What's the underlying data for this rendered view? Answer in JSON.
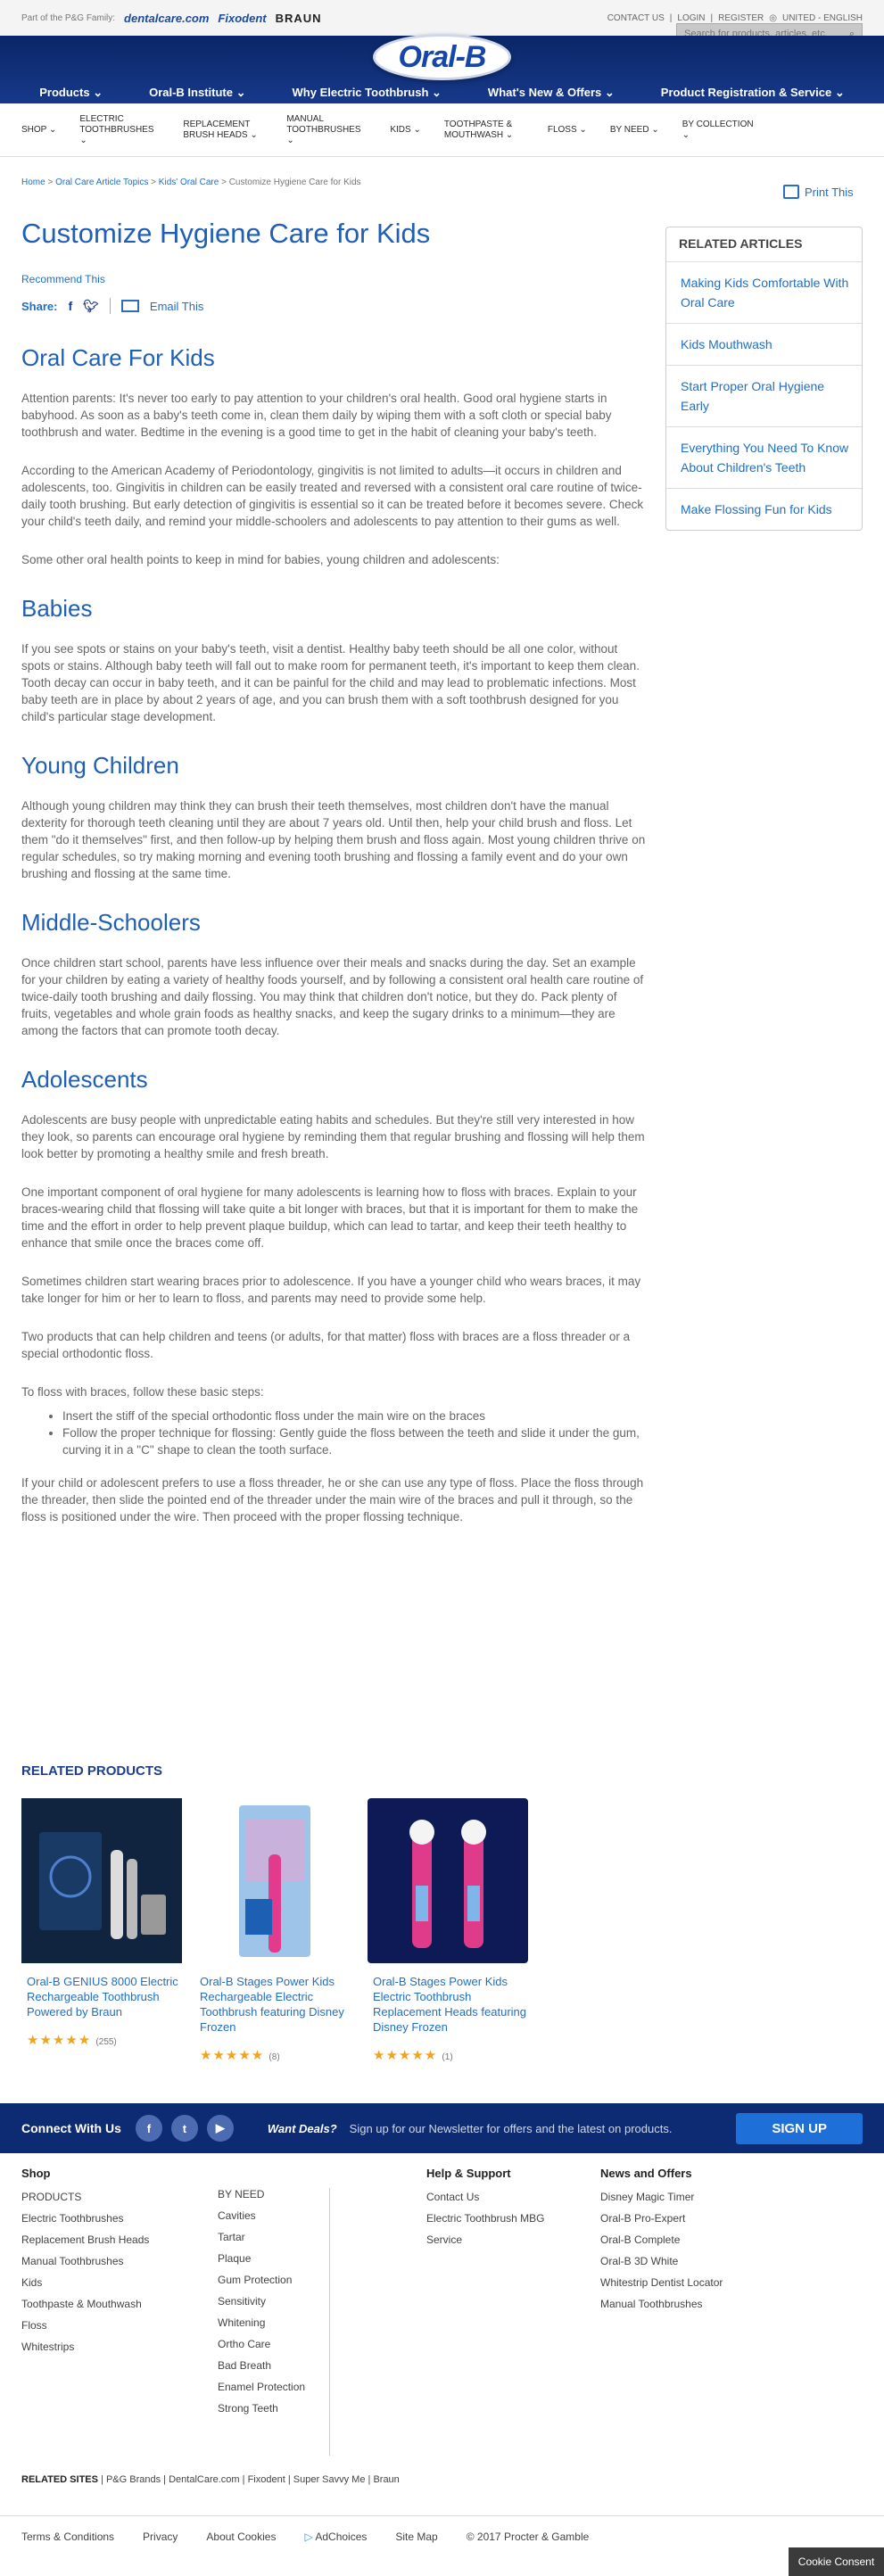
{
  "topbar": {
    "family_label": "Part of the P&G Family:",
    "brands": [
      "dentalcare.com",
      "Fixodent",
      "BRAUN"
    ],
    "contact": "CONTACT US",
    "login": "LOGIN",
    "register": "REGISTER",
    "region": "UNITED - ENGLISH"
  },
  "search": {
    "placeholder": "Search for products, articles, etc."
  },
  "logo": "Oral-B",
  "main_nav": [
    "Products",
    "Oral-B Institute",
    "Why Electric Toothbrush",
    "What's New & Offers",
    "Product Registration & Service"
  ],
  "category_nav": [
    "SHOP",
    "ELECTRIC TOOTHBRUSHES",
    "REPLACEMENT BRUSH HEADS",
    "MANUAL TOOTHBRUSHES",
    "KIDS",
    "TOOTHPASTE & MOUTHWASH",
    "FLOSS",
    "BY NEED",
    "BY COLLECTION"
  ],
  "breadcrumbs": [
    "Home",
    "Oral Care Article Topics",
    "Kids' Oral Care",
    "Customize Hygiene Care for Kids"
  ],
  "print_label": "Print This",
  "article": {
    "title": "Customize Hygiene Care for Kids",
    "recommend": "Recommend This",
    "share_label": "Share:",
    "email_label": "Email This",
    "intro_heading": "Oral Care For Kids",
    "intro_p1": "Attention parents: It's never too early to pay attention to your children's oral health. Good oral hygiene starts in babyhood. As soon as a baby's teeth come in, clean them daily by wiping them with a soft cloth or special baby toothbrush and water. Bedtime in the evening is a good time to get in the habit of cleaning your baby's teeth.",
    "intro_p2": "According to the American Academy of Periodontology, gingivitis is not limited to adults—it occurs in children and adolescents, too. Gingivitis in children can be easily treated and reversed with a consistent oral care routine of twice-daily tooth brushing. But early detection of gingivitis is essential so it can be treated before it becomes severe. Check your child's teeth daily, and remind your middle-schoolers and adolescents to pay attention to their gums as well.",
    "intro_p3": "Some other oral health points to keep in mind for babies, young children and adolescents:",
    "babies_heading": "Babies",
    "babies_p": "If you see spots or stains on your baby's teeth, visit a dentist. Healthy baby teeth should be all one color, without spots or stains. Although baby teeth will fall out to make room for permanent teeth, it's important to keep them clean. Tooth decay can occur in baby teeth, and it can be painful for the child and may lead to problematic infections. Most baby teeth are in place by about 2 years of age, and you can brush them with a soft toothbrush designed for you child's particular stage development.",
    "young_heading": "Young Children",
    "young_p": "Although young children may think they can brush their teeth themselves, most children don't have the manual dexterity for thorough teeth cleaning until they are about 7 years old. Until then, help your child brush and floss. Let them \"do it themselves\" first, and then follow-up by helping them brush and floss again. Most young children thrive on regular schedules, so try making morning and evening tooth brushing and flossing a family event and do your own brushing and flossing at the same time.",
    "middle_heading": "Middle-Schoolers",
    "middle_p": "Once children start school, parents have less influence over their meals and snacks during the day. Set an example for your children by eating a variety of healthy foods yourself, and by following a consistent oral health care routine of twice-daily tooth brushing and daily flossing. You may think that children don't notice, but they do. Pack plenty of fruits, vegetables and whole grain foods as healthy snacks, and keep the sugary drinks to a minimum—they are among the factors that can promote tooth decay.",
    "adol_heading": "Adolescents",
    "adol_p1": "Adolescents are busy people with unpredictable eating habits and schedules. But they're still very interested in how they look, so parents can encourage oral hygiene by reminding them that regular brushing and flossing will help them look better by promoting a healthy smile and fresh breath.",
    "adol_p2": "One important component of oral hygiene for many adolescents is learning how to floss with braces. Explain to your braces-wearing child that flossing will take quite a bit longer with braces, but that it is important for them to make the time and the effort in order to help prevent plaque buildup, which can lead to tartar, and keep their teeth healthy to enhance that smile once the braces come off.",
    "adol_p3": "Sometimes children start wearing braces prior to adolescence. If you have a younger child who wears braces, it may take longer for him or her to learn to floss, and parents may need to provide some help.",
    "adol_p4": "Two products that can help children and teens (or adults, for that matter) floss with braces are a floss threader or a special orthodontic floss.",
    "adol_p5": "To floss with braces, follow these basic steps:",
    "steps": [
      "Insert the stiff of the special orthodontic floss under the main wire on the braces",
      "Follow the proper technique for flossing: Gently guide the floss between the teeth and slide it under the gum, curving it in a \"C\" shape to clean the tooth surface."
    ],
    "adol_p6": "If your child or adolescent prefers to use a floss threader, he or she can use any type of floss. Place the floss through the threader, then slide the pointed end of the threader under the main wire of the braces and pull it through, so the floss is positioned under the wire. Then proceed with the proper flossing technique."
  },
  "related_articles": {
    "title": "RELATED ARTICLES",
    "items": [
      "Making Kids Comfortable With Oral Care",
      "Kids Mouthwash",
      "Start Proper Oral Hygiene Early",
      "Everything You Need To Know About Children's Teeth",
      "Make Flossing Fun for Kids"
    ]
  },
  "related_products": {
    "title": "RELATED PRODUCTS",
    "items": [
      {
        "name": "Oral-B GENIUS 8000 Electric Rechargeable Toothbrush Powered by Braun",
        "stars": "★★★★★",
        "count": "(255)"
      },
      {
        "name": "Oral-B Stages Power Kids Rechargeable Electric Toothbrush featuring Disney Frozen",
        "stars": "★★★★★",
        "count": "(8)"
      },
      {
        "name": "Oral-B Stages Power Kids Electric Toothbrush Replacement Heads featuring Disney Frozen",
        "stars": "★★★★★",
        "count": "(1)"
      }
    ]
  },
  "connect": {
    "label": "Connect With Us",
    "deals": "Want Deals?",
    "newsletter": "Sign up for our Newsletter for offers and the latest on products.",
    "signup": "SIGN UP"
  },
  "footer": {
    "shop_title": "Shop",
    "shop_col1": [
      "PRODUCTS",
      "Electric Toothbrushes",
      "Replacement Brush Heads",
      "Manual Toothbrushes",
      "Kids",
      "Toothpaste & Mouthwash",
      "Floss",
      "Whitestrips"
    ],
    "shop_col2": [
      "BY NEED",
      "Cavities",
      "Tartar",
      "Plaque",
      "Gum Protection",
      "Sensitivity",
      "Whitening",
      "Ortho Care",
      "Bad Breath",
      "Enamel Protection",
      "Strong Teeth"
    ],
    "help_title": "Help & Support",
    "help_items": [
      "Contact Us",
      "Electric Toothbrush MBG",
      "Service"
    ],
    "news_title": "News and Offers",
    "news_items": [
      "Disney Magic Timer",
      "Oral-B Pro-Expert",
      "Oral-B Complete",
      "Oral-B 3D White",
      "Whitestrip Dentist Locator",
      "Manual Toothbrushes"
    ]
  },
  "related_sites": {
    "label": "RELATED SITES",
    "items": [
      "P&G Brands",
      "DentalCare.com",
      "Fixodent",
      "Super Savvy Me",
      "Braun"
    ]
  },
  "bottom": [
    "Terms & Conditions",
    "Privacy",
    "About Cookies",
    "AdChoices",
    "Site Map",
    "© 2017 Procter & Gamble"
  ],
  "cookie": "Cookie Consent"
}
